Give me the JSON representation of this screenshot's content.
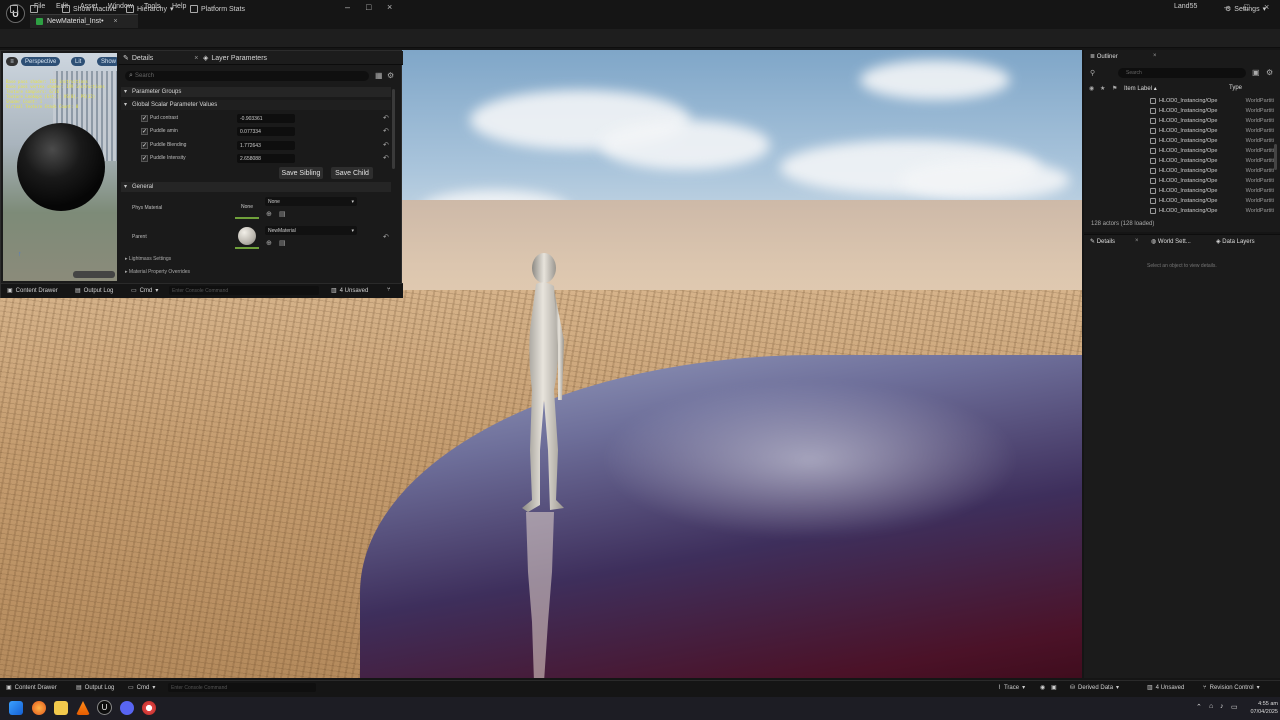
{
  "menubar": {
    "logo": "U",
    "items": [
      "File",
      "Edit",
      "Asset",
      "Window",
      "Tools",
      "Help"
    ],
    "project": "Land55",
    "asset_tab": "NewMaterial_Inst•",
    "close": "×",
    "min": "–",
    "max": "□"
  },
  "toolbar": {
    "show_inactive": "Show Inactive",
    "hierarchy": "Hierarchy",
    "platform_stats": "Platform Stats",
    "settings": "Settings"
  },
  "material_editor": {
    "preview": {
      "perspective": "Perspective",
      "lit": "Lit",
      "show": "Show",
      "stats_text": "Base pass shader: 153 instructions\nBase pass vertex shader: 149 instructions\nTexture samplers: 6/16\nTexture Lookups (Est.): VS(0), PS(12)\nShader Count: 1\nVirtual Texture Stack Count: 0"
    },
    "tabs": {
      "details": "Details",
      "layer_parameters": "Layer Parameters"
    },
    "search_placeholder": "Search",
    "sections": {
      "parameter_groups": "Parameter Groups",
      "global_scalar": "Global Scalar Parameter Values",
      "general": "General",
      "lightmass": "Lightmass Settings",
      "overrides": "Material Property Overrides"
    },
    "params": [
      {
        "label": "Pud contrast",
        "value": "-0.903361"
      },
      {
        "label": "Puddle amin",
        "value": "0.077334"
      },
      {
        "label": "Puddle Blending",
        "value": "1.772643"
      },
      {
        "label": "Puddle Intensity",
        "value": "2.658088"
      }
    ],
    "save_sibling": "Save Sibling",
    "save_child": "Save Child",
    "phys_material": {
      "label": "Phys Material",
      "thumb": "None",
      "value": "None"
    },
    "parent": {
      "label": "Parent",
      "value": "NewMaterial"
    },
    "bottom": {
      "content_drawer": "Content Drawer",
      "output_log": "Output Log",
      "cmd": "Cmd",
      "console_placeholder": "Enter Console Command",
      "unsaved": "4 Unsaved"
    }
  },
  "outliner": {
    "title": "Outliner",
    "search_placeholder": "Search",
    "col_label": "Item Label",
    "col_type": "Type",
    "rows": [
      {
        "label": "HLOD0_Instancing/Ope",
        "type": "WorldPartiti"
      },
      {
        "label": "HLOD0_Instancing/Ope",
        "type": "WorldPartiti"
      },
      {
        "label": "HLOD0_Instancing/Ope",
        "type": "WorldPartiti"
      },
      {
        "label": "HLOD0_Instancing/Ope",
        "type": "WorldPartiti"
      },
      {
        "label": "HLOD0_Instancing/Ope",
        "type": "WorldPartiti"
      },
      {
        "label": "HLOD0_Instancing/Ope",
        "type": "WorldPartiti"
      },
      {
        "label": "HLOD0_Instancing/Ope",
        "type": "WorldPartiti"
      },
      {
        "label": "HLOD0_Instancing/Ope",
        "type": "WorldPartiti"
      },
      {
        "label": "HLOD0_Instancing/Ope",
        "type": "WorldPartiti"
      },
      {
        "label": "HLOD0_Instancing/Ope",
        "type": "WorldPartiti"
      },
      {
        "label": "HLOD0_Instancing/Ope",
        "type": "WorldPartiti"
      },
      {
        "label": "HLOD0_Instancing/Ope",
        "type": "WorldPartiti"
      }
    ],
    "actor_count": "128 actors (128 loaded)"
  },
  "details_panel": {
    "tabs": [
      "Details",
      "World Sett...",
      "Data Layers"
    ],
    "empty": "Select an object to view details."
  },
  "statusbar": {
    "content_drawer": "Content Drawer",
    "output_log": "Output Log",
    "cmd": "Cmd",
    "console_placeholder": "Enter Console Command",
    "trace": "Trace",
    "derived_data": "Derived Data",
    "unsaved": "4 Unsaved",
    "revision_control": "Revision Control"
  },
  "taskbar": {
    "time": "4:55 am",
    "date": "07/04/2025"
  },
  "colors": {
    "accent": "#2d4f75",
    "check": "#2ea043",
    "water": "#4b1228"
  }
}
